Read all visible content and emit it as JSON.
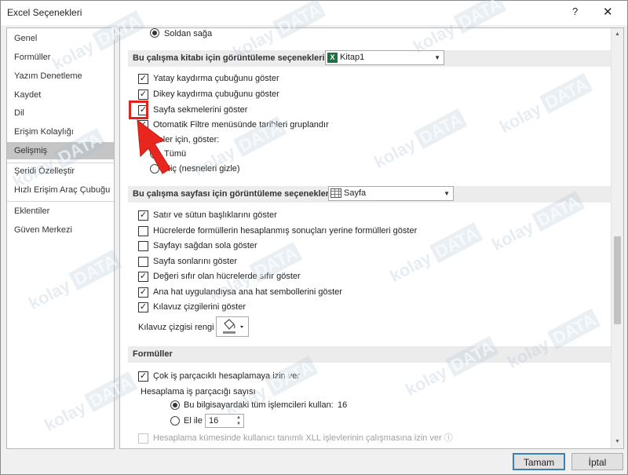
{
  "window": {
    "title": "Excel Seçenekleri",
    "help_label": "?",
    "close_label": "✕"
  },
  "sidebar": {
    "items": [
      {
        "label": "Genel"
      },
      {
        "label": "Formüller"
      },
      {
        "label": "Yazım Denetleme"
      },
      {
        "label": "Kaydet"
      },
      {
        "label": "Dil"
      },
      {
        "label": "Erişim Kolaylığı"
      },
      {
        "label": "Gelişmiş"
      },
      {
        "label": "Şeridi Özelleştir"
      },
      {
        "label": "Hızlı Erişim Araç Çubuğu"
      },
      {
        "label": "Eklentiler"
      },
      {
        "label": "Güven Merkezi"
      }
    ],
    "active_index": 6
  },
  "main": {
    "top_radio_label": "Soldan sağa",
    "workbook_section": {
      "header": "Bu çalışma kitabı için görüntüleme seçenekleri:",
      "combo_value": "Kitap1",
      "combo_icon": "X",
      "options": [
        {
          "label": "Yatay kaydırma çubuğunu göster",
          "checked": true
        },
        {
          "label": "Dikey kaydırma çubuğunu göster",
          "checked": true
        },
        {
          "label": "Sayfa sekmelerini göster",
          "checked": true
        },
        {
          "label": "Otomatik Filtre menüsünde tarihleri gruplandır",
          "checked": true
        }
      ],
      "objects_group_label": "Nesneler için, göster:",
      "objects_radios": [
        {
          "label": "Tümü",
          "selected": true
        },
        {
          "label": "Hiç (nesneleri gizle)",
          "selected": false
        }
      ]
    },
    "worksheet_section": {
      "header": "Bu çalışma sayfası için görüntüleme seçenekleri:",
      "combo_value": "Sayfa",
      "options": [
        {
          "label": "Satır ve sütun başlıklarını göster",
          "checked": true
        },
        {
          "label": "Hücrelerde formüllerin hesaplanmış sonuçları yerine formülleri göster",
          "checked": false
        },
        {
          "label": "Sayfayı sağdan sola göster",
          "checked": false
        },
        {
          "label": "Sayfa sonlarını göster",
          "checked": false
        },
        {
          "label": "Değeri sıfır olan hücrelerde sıfır göster",
          "checked": true
        },
        {
          "label": "Ana hat uygulandıysa ana hat sembollerini göster",
          "checked": true
        },
        {
          "label": "Kılavuz çizgilerini göster",
          "checked": true
        }
      ],
      "gridline_color_label": "Kılavuz çizgisi rengi"
    },
    "formulas_section": {
      "header": "Formüller",
      "multithread_label": "Çok iş parçacıklı hesaplamaya izin ver",
      "multithread_checked": true,
      "threads_label": "Hesaplama iş parçacığı sayısı",
      "use_all_label": "Bu bilgisayardaki tüm işlemcileri kullan:",
      "use_all_value": "16",
      "manual_label": "El ile",
      "manual_value": "16",
      "xll_label": "Hesaplama kümesinde kullanıcı tanımlı XLL işlevlerinin çalışmasına izin ver"
    }
  },
  "footer": {
    "ok_label": "Tamam",
    "cancel_label": "İptal"
  },
  "watermark": {
    "text_a": "kolay",
    "text_b": "DATA"
  },
  "colors": {
    "highlight": "#e0241b",
    "arrow": "#e8261d",
    "excel_green": "#1e7145",
    "ok_border": "#3c7fb1"
  }
}
